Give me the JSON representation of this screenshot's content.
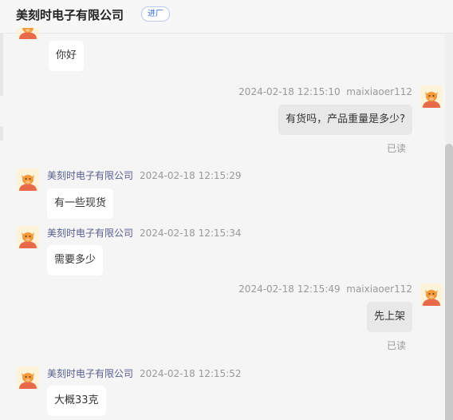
{
  "header": {
    "shop_name": "美刻时电子有限公司",
    "tag": "进厂"
  },
  "colors": {
    "accent": "#3b6fd8",
    "avatar_bg": "#fdf3d8",
    "avatar_orange": "#f39a3c",
    "avatar_red": "#e86a4a",
    "self_bubble": "#e8e8e8",
    "other_bubble": "#ffffff"
  },
  "avatar_icon": "cartoon-cow-avatar",
  "messages": [
    {
      "side": "left",
      "text": "你好"
    },
    {
      "side": "right",
      "sender": "maixiaoer112",
      "time": "2024-02-18 12:15:10",
      "text": "有货吗，产品重量是多少?",
      "status": "已读"
    },
    {
      "side": "left",
      "sender": "美刻时电子有限公司",
      "time": "2024-02-18 12:15:29",
      "text": "有一些现货"
    },
    {
      "side": "left",
      "sender": "美刻时电子有限公司",
      "time": "2024-02-18 12:15:34",
      "text": "需要多少"
    },
    {
      "side": "right",
      "sender": "maixiaoer112",
      "time": "2024-02-18 12:15:49",
      "text": "先上架",
      "status": "已读"
    },
    {
      "side": "left",
      "sender": "美刻时电子有限公司",
      "time": "2024-02-18 12:15:52",
      "text": "大概33克"
    }
  ]
}
